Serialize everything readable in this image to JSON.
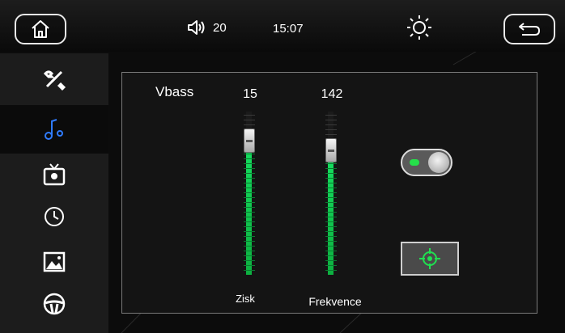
{
  "status_bar": {
    "volume": "20",
    "time": "15:07"
  },
  "sidebar": {
    "items": [
      {
        "icon": "tools-icon"
      },
      {
        "icon": "music-settings-icon",
        "active": true
      },
      {
        "icon": "tv-settings-icon"
      },
      {
        "icon": "clock-icon"
      },
      {
        "icon": "image-icon"
      },
      {
        "icon": "steering-wheel-icon"
      }
    ]
  },
  "panel": {
    "title": "Vbass",
    "gain": {
      "value": "15",
      "label": "Zisk",
      "level": 0.82
    },
    "frequency": {
      "value": "142",
      "label": "Frekvence",
      "level": 0.76
    },
    "toggle_on": true
  },
  "colors": {
    "accent_green": "#15e060",
    "active_icon_blue": "#2f7bff"
  }
}
